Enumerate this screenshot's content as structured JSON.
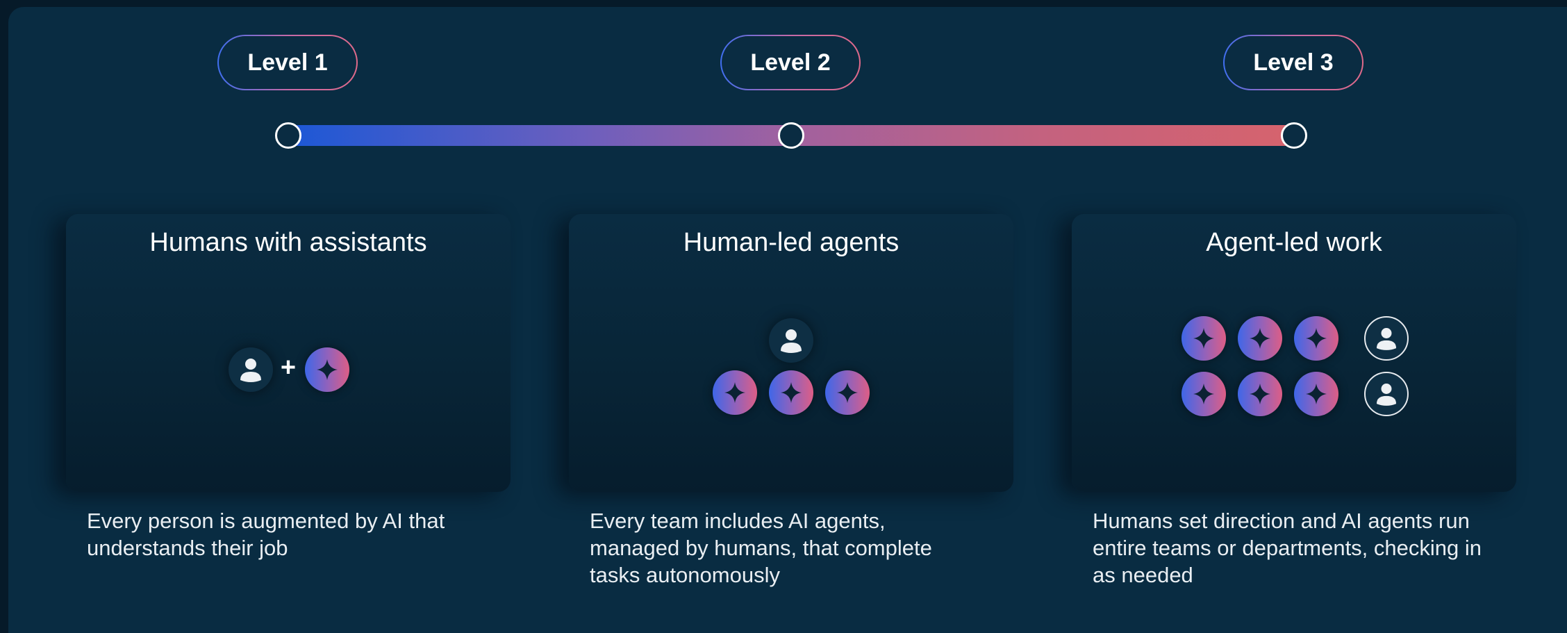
{
  "levels": [
    {
      "label": "Level 1",
      "title": "Humans with assistants",
      "description": "Every person is augmented by AI that understands their job",
      "icons": [
        "person-icon",
        "plus",
        "sparkle-icon"
      ]
    },
    {
      "label": "Level 2",
      "title": "Human-led agents",
      "description": "Every team includes AI agents, managed by humans, that complete tasks autonomously",
      "icons": [
        "person-icon",
        "sparkle-icon",
        "sparkle-icon",
        "sparkle-icon"
      ]
    },
    {
      "label": "Level 3",
      "title": "Agent-led work",
      "description": "Humans set direction and AI agents run entire teams or departments, checking in as needed",
      "icons": [
        "sparkle-icon",
        "sparkle-icon",
        "sparkle-icon",
        "person-icon",
        "sparkle-icon",
        "sparkle-icon",
        "sparkle-icon",
        "person-icon"
      ]
    }
  ],
  "plus_symbol": "+",
  "colors": {
    "background": "#092c42",
    "gradient_start": "#1c58d6",
    "gradient_mid": "#a1619f",
    "gradient_end": "#d6636d",
    "text": "#ffffff"
  }
}
